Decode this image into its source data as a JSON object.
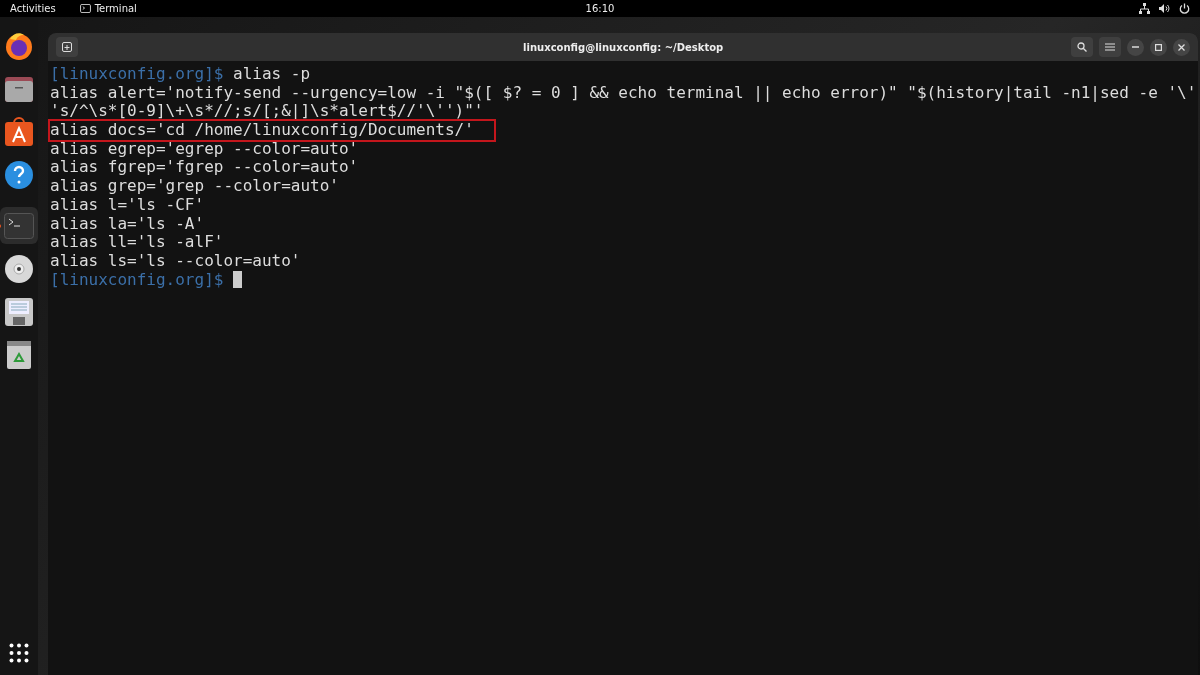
{
  "top_bar": {
    "activities": "Activities",
    "app_name": "Terminal",
    "clock": "16:10"
  },
  "dock": {
    "items": [
      {
        "kind": "browser",
        "running": false
      },
      {
        "kind": "files",
        "running": false
      },
      {
        "kind": "store",
        "running": false
      },
      {
        "kind": "help",
        "running": false
      },
      {
        "kind": "terminal",
        "running": true
      },
      {
        "kind": "disc",
        "running": false
      },
      {
        "kind": "drive",
        "running": false
      },
      {
        "kind": "trash",
        "running": false
      }
    ]
  },
  "window": {
    "title": "linuxconfig@linuxconfig: ~/Desktop"
  },
  "terminal": {
    "lines": [
      {
        "kind": "prompt",
        "prompt": "[linuxconfig.org]$",
        "text": " alias -p",
        "cursor": false
      },
      {
        "kind": "output",
        "text": "alias alert='notify-send --urgency=low -i \"$([ $? = 0 ] && echo terminal || echo error)\" \"$(history|tail -n1|sed -e '\\'",
        "highlighted": false
      },
      {
        "kind": "output",
        "text": "'s/^\\s*[0-9]\\+\\s*//;s/[;&|]\\s*alert$//'\\'')\"'",
        "highlighted": false
      },
      {
        "kind": "output",
        "text": "alias docs='cd /home/linuxconfig/Documents/'",
        "highlighted": true
      },
      {
        "kind": "output",
        "text": "alias egrep='egrep --color=auto'",
        "highlighted": false
      },
      {
        "kind": "output",
        "text": "alias fgrep='fgrep --color=auto'",
        "highlighted": false
      },
      {
        "kind": "output",
        "text": "alias grep='grep --color=auto'",
        "highlighted": false
      },
      {
        "kind": "output",
        "text": "alias l='ls -CF'",
        "highlighted": false
      },
      {
        "kind": "output",
        "text": "alias la='ls -A'",
        "highlighted": false
      },
      {
        "kind": "output",
        "text": "alias ll='ls -alF'",
        "highlighted": false
      },
      {
        "kind": "output",
        "text": "alias ls='ls --color=auto'",
        "highlighted": false
      },
      {
        "kind": "prompt",
        "prompt": "[linuxconfig.org]$",
        "cursor": true
      }
    ]
  }
}
